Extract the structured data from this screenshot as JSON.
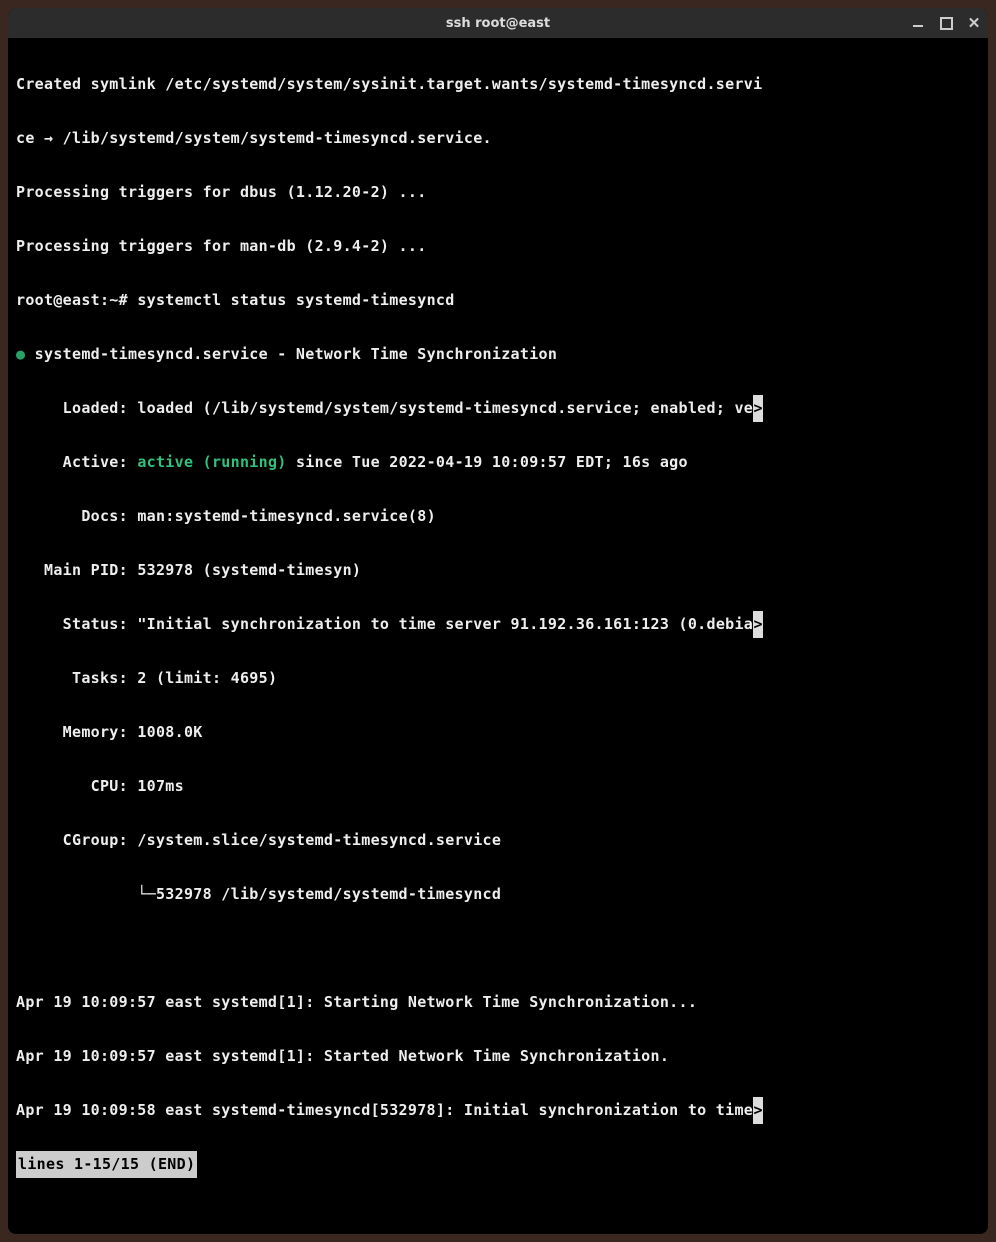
{
  "titlebar": {
    "title": "ssh root@east"
  },
  "scrollback": {
    "l1": "Created symlink /etc/systemd/system/sysinit.target.wants/systemd-timesyncd.servi",
    "l2": "ce → /lib/systemd/system/systemd-timesyncd.service.",
    "l3": "Processing triggers for dbus (1.12.20-2) ...",
    "l4": "Processing triggers for man-db (2.9.4-2) ..."
  },
  "prompt": {
    "text": "root@east:~# ",
    "cmd": "systemctl status systemd-timesyncd"
  },
  "status": {
    "dot": "●",
    "header": " systemd-timesyncd.service - Network Time Synchronization",
    "loaded_label": "     Loaded: ",
    "loaded_value": "loaded (/lib/systemd/system/systemd-timesyncd.service; enabled; ve",
    "active_label": "     Active: ",
    "active_value": "active (running)",
    "active_tail": " since Tue 2022-04-19 10:09:57 EDT; 16s ago",
    "docs_label": "       Docs: ",
    "docs_value": "man:systemd-timesyncd.service(8)",
    "mainpid_label": "   Main PID: ",
    "mainpid_value": "532978 (systemd-timesyn)",
    "status_label": "     Status: ",
    "status_value": "\"Initial synchronization to time server 91.192.36.161:123 (0.debia",
    "tasks_label": "      Tasks: ",
    "tasks_value": "2 (limit: 4695)",
    "memory_label": "     Memory: ",
    "memory_value": "1008.0K",
    "cpu_label": "        CPU: ",
    "cpu_value": "107ms",
    "cgroup_label": "     CGroup: ",
    "cgroup_value": "/system.slice/systemd-timesyncd.service",
    "cgroup_tree": "             └─532978 /lib/systemd/systemd-timesyncd"
  },
  "journal": {
    "j1": "Apr 19 10:09:57 east systemd[1]: Starting Network Time Synchronization...",
    "j2": "Apr 19 10:09:57 east systemd[1]: Started Network Time Synchronization.",
    "j3": "Apr 19 10:09:58 east systemd-timesyncd[532978]: Initial synchronization to time"
  },
  "pager": {
    "status": "lines 1-15/15 (END)"
  },
  "glyphs": {
    "overflow": ">"
  }
}
